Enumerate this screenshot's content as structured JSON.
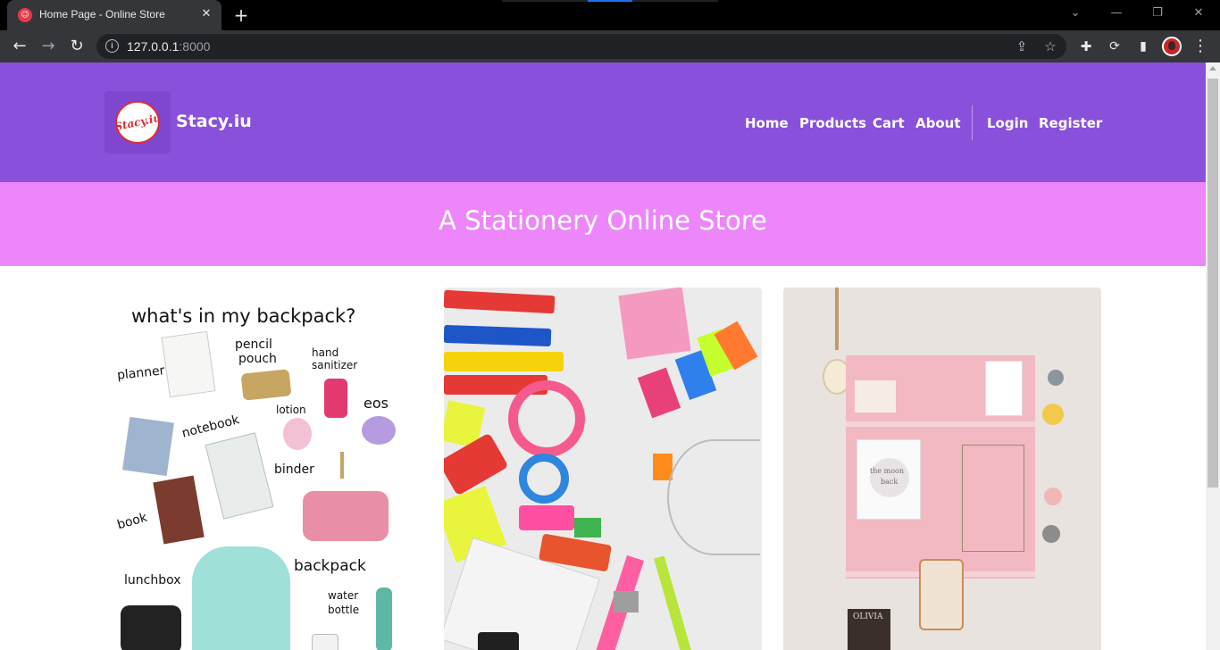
{
  "browser": {
    "tab_title": "Home Page - Online Store",
    "url_host": "127.0.0.1",
    "url_port": ":8000"
  },
  "site": {
    "logo_text": "Stacy.iu",
    "brand": "Stacy.iu",
    "nav": {
      "home": "Home",
      "products": "Products",
      "cart": "Cart",
      "about": "About",
      "login": "Login",
      "register": "Register"
    },
    "hero_title": "A Stationery Online Store"
  },
  "backpack_card": {
    "title": "what's in my backpack?",
    "labels": {
      "planner": "planner",
      "pencil_pouch_1": "pencil",
      "pencil_pouch_2": "pouch",
      "hand_sanitizer_1": "hand",
      "hand_sanitizer_2": "sanitizer",
      "eos": "eos",
      "notebook": "notebook",
      "lotion": "lotion",
      "binder": "binder",
      "book": "book",
      "lunchbox": "lunchbox",
      "backpack": "backpack",
      "water_bottle_1": "water",
      "water_bottle_2": "bottle"
    }
  },
  "shelf_card": {
    "poster_text_1": "the moon",
    "poster_text_2": "back",
    "book_spine": "OLIVIA"
  },
  "colors": {
    "navbar": "#8950db",
    "hero": "#ee86fb",
    "chrome_dark": "#35363a"
  }
}
